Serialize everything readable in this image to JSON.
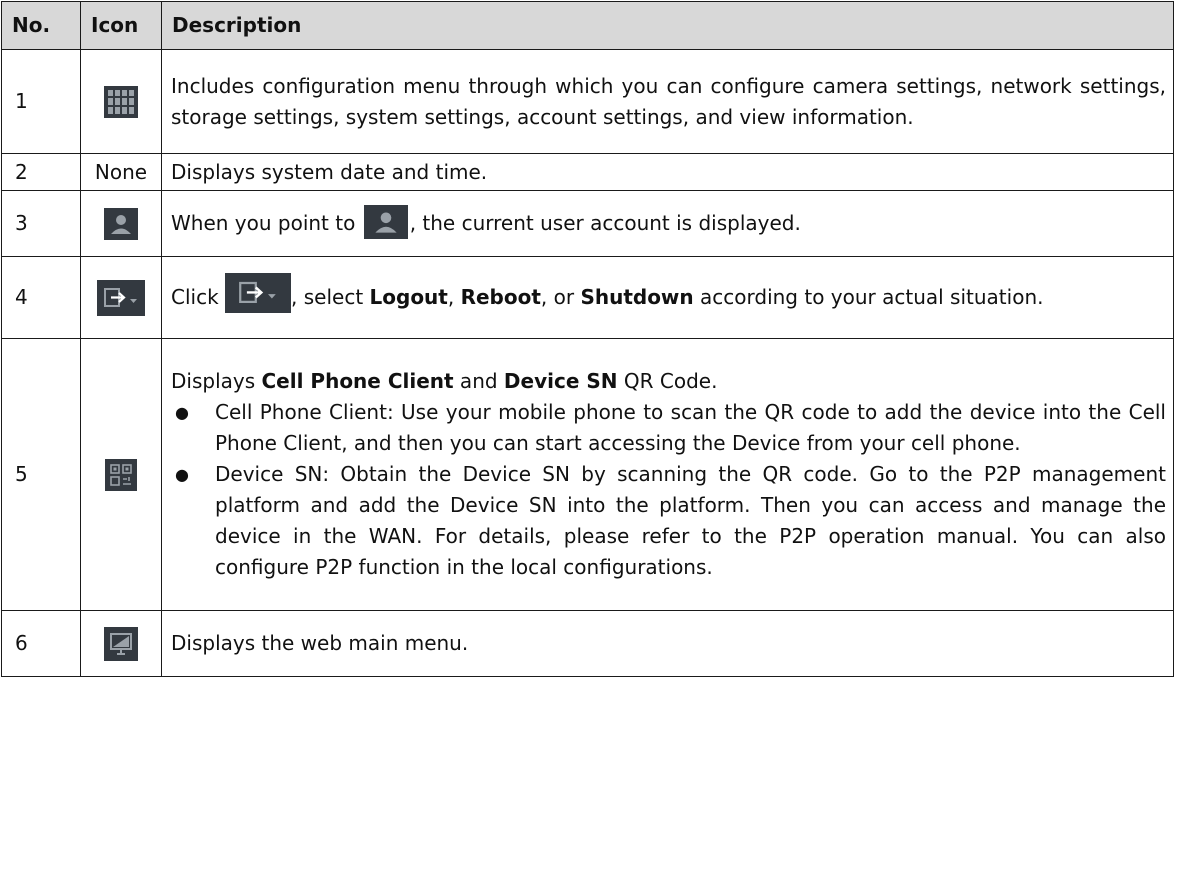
{
  "table": {
    "headers": {
      "no": "No.",
      "icon": "Icon",
      "description": "Description"
    },
    "rows": [
      {
        "no": "1",
        "icon": "grid-menu-icon",
        "description": "Includes configuration menu through which you can configure camera settings, network settings, storage settings, system settings, account settings, and view information."
      },
      {
        "no": "2",
        "icon_text": "None",
        "description": "Displays system date and time."
      },
      {
        "no": "3",
        "icon": "user-account-icon",
        "description_parts": {
          "before": "When you point to ",
          "after": ", the current user account is displayed."
        }
      },
      {
        "no": "4",
        "icon": "logout-dropdown-icon",
        "description_parts": {
          "before": "Click ",
          "after_icon": ", select ",
          "bold1": "Logout",
          "sep1": ", ",
          "bold2": "Reboot",
          "sep2": ", or ",
          "bold3": "Shutdown",
          "after": " according to your actual situation."
        }
      },
      {
        "no": "5",
        "icon": "qr-code-icon",
        "description_parts": {
          "intro_before": "Displays ",
          "intro_bold1": "Cell Phone Client",
          "intro_mid": " and ",
          "intro_bold2": "Device SN",
          "intro_after": " QR Code.",
          "bullets": [
            "Cell Phone Client: Use your mobile phone to scan the QR code to add the device into the Cell Phone Client, and then you can start accessing the Device from your cell phone.",
            "Device SN: Obtain the Device SN by scanning the QR code. Go to the P2P management platform and add the Device SN into the platform. Then you can access and manage the device in the WAN. For details, please refer to the P2P operation manual. You can also configure P2P function in the local configurations."
          ],
          "bullet_symbol": "●"
        }
      },
      {
        "no": "6",
        "icon": "monitor-icon",
        "description": "Displays the web main menu."
      }
    ]
  },
  "colors": {
    "header_bg": "#d8d8d8",
    "icon_bg": "#333940",
    "icon_fg": "#9aa1a8",
    "border": "#1a1a1a"
  }
}
